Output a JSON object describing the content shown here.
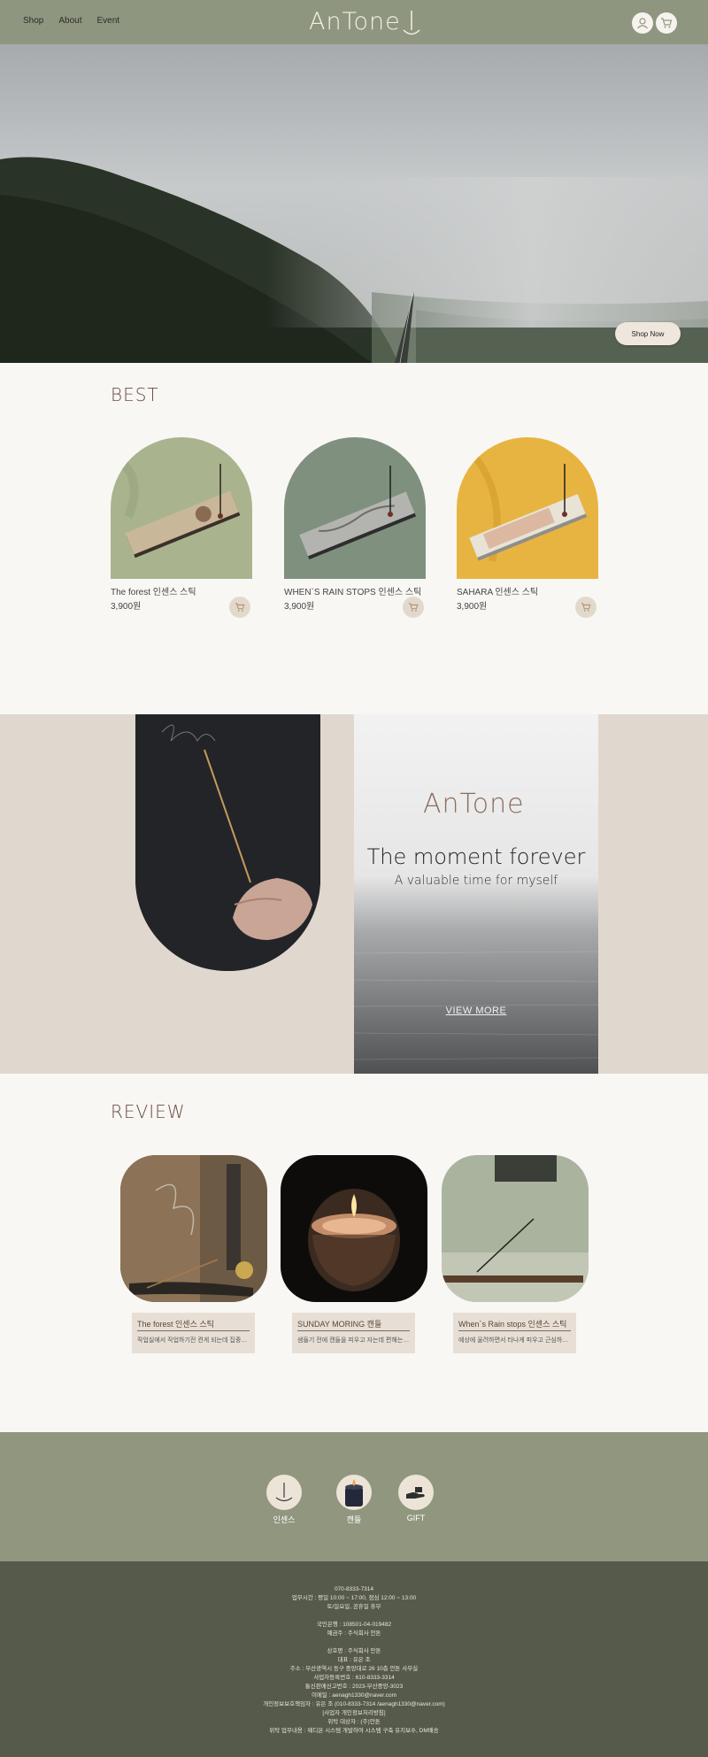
{
  "header": {
    "nav": [
      "Shop",
      "About",
      "Event"
    ],
    "logo_text": "AnTone",
    "icons": [
      "user-icon",
      "cart-icon"
    ]
  },
  "hero": {
    "cta_label": "Shop Now"
  },
  "best": {
    "title": "BEST",
    "products": [
      {
        "name": "The forest 인센스 스틱",
        "price": "3,900원"
      },
      {
        "name": "WHEN`S RAIN STOPS 인센스 스틱",
        "price": "3,900원"
      },
      {
        "name": "SAHARA 인센스 스틱",
        "price": "3,900원"
      }
    ]
  },
  "promo": {
    "logo_text": "AnTone",
    "headline": "The moment forever",
    "subline": "A valuable time for myself",
    "link_label": "VIEW MORE"
  },
  "review": {
    "title": "REVIEW",
    "items": [
      {
        "title": "The forest 인센스 스틱",
        "text": "작업실에서 작업하기전 켠게 되는데 집중도..."
      },
      {
        "title": "SUNDAY MORING 캔들",
        "text": "샘들기 전에 캔들을 피우고 자는데 편해는 불안운..."
      },
      {
        "title": "When`s Rain stops 인센스 스틱",
        "text": "예상에 울려하면서 타나게 피우고 근심하는데..."
      }
    ]
  },
  "categories": [
    {
      "label": "인센스",
      "icon": "incense-icon"
    },
    {
      "label": "캔들",
      "icon": "candle-icon"
    },
    {
      "label": "GIFT",
      "icon": "gift-hand-icon"
    }
  ],
  "footer": {
    "lines": [
      "070-8333-7314",
      "업무시간 : 평일 10:00 ~ 17:00, 점심 12:00 ~ 13:00",
      "토/일요일, 공휴일 휴무",
      "",
      "국민은행 : 108501-04-019482",
      "예금주 : 주식회사 안톤",
      "",
      "상호명 : 주식회사 안톤",
      "대표 : 유은 조",
      "주소 : 부산광역시 동구 중앙대로 26 10층 안톤 사무실",
      "사업자등록번호 : 610-8333-3314",
      "통신판매신고번호 : 2023-부산중앙-3023",
      "이메일 : aenagh1330@naver.com",
      "개인정보보호책임자 : 유은 조 (010-8333-7314 /aenagh1330@naver.com)",
      "[사업자 개인정보처리방침]",
      "위탁 대상자 : (주)안톤",
      "위탁 업무내용 : 웨디온 시스템 개발하여 시스템 구축 유지보수, DM배송"
    ]
  },
  "colors": {
    "header_bg": "#8f967f",
    "page_bg": "#f8f7f4",
    "promo_bg": "#e0d8ce",
    "footer_bg": "#565a4b",
    "accent_brown": "#6b4a3e"
  }
}
